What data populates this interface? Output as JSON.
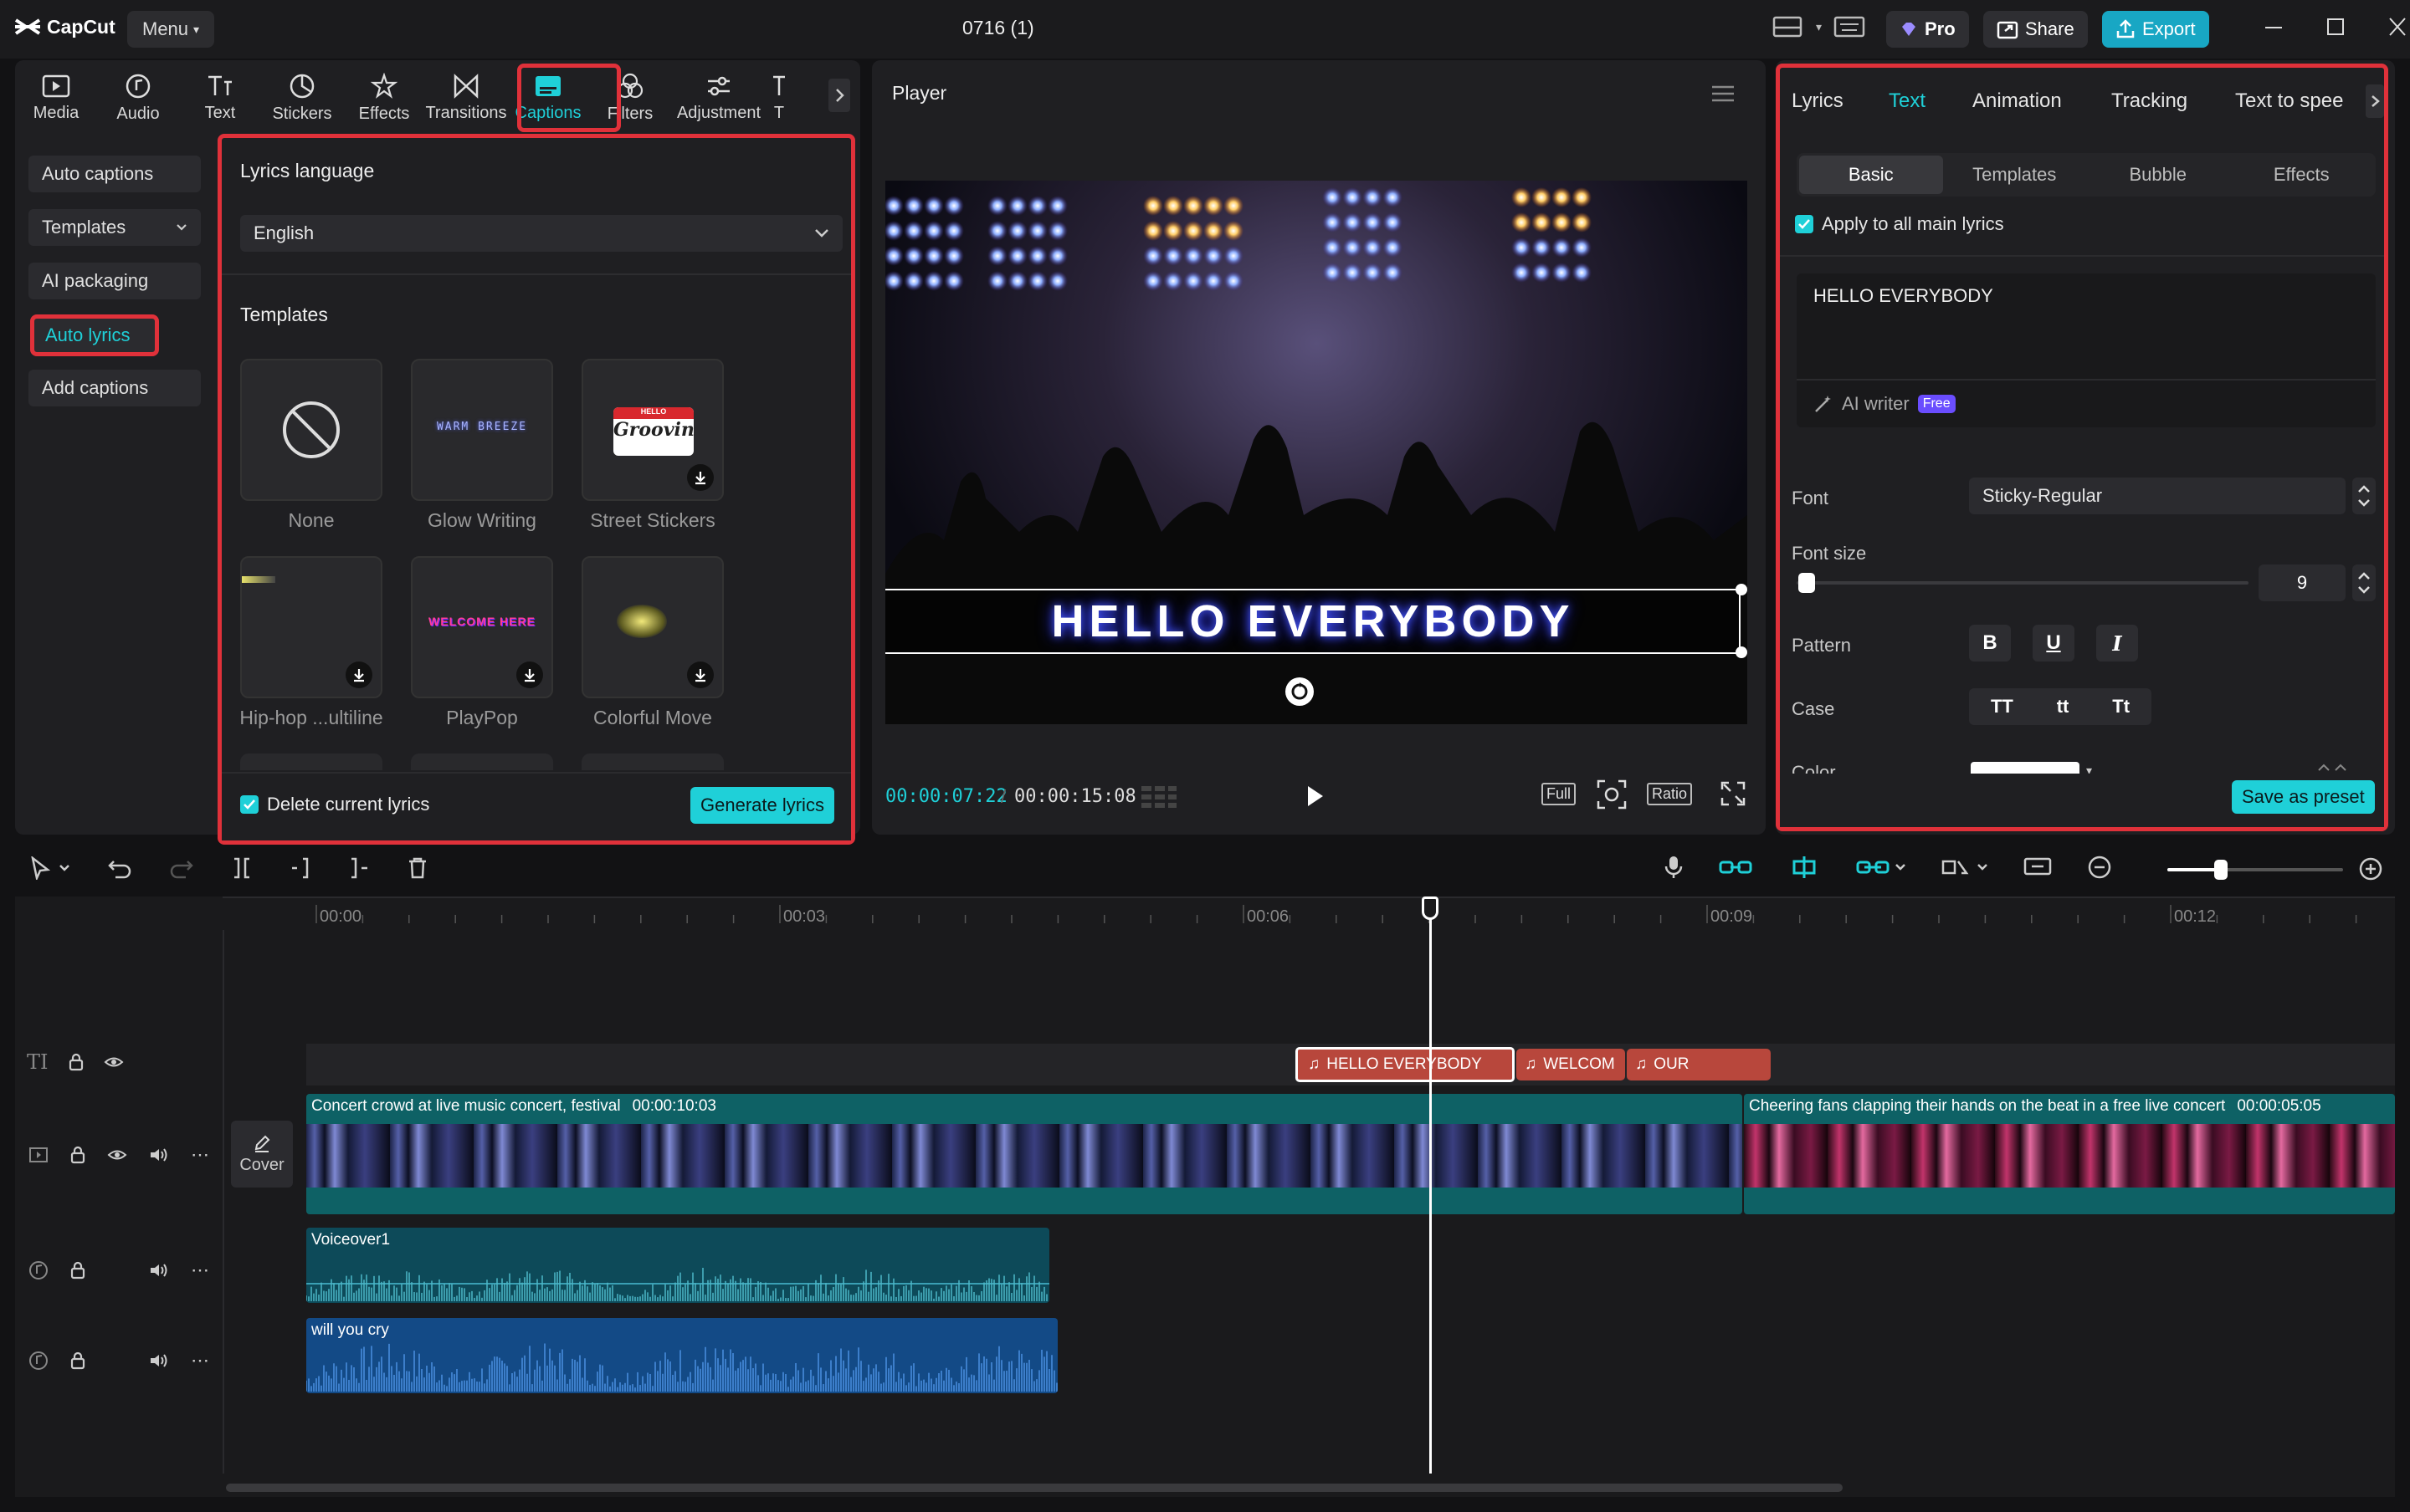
{
  "app": {
    "logo": "CapCut",
    "menu": "Menu",
    "title": "0716 (1)",
    "pro": "Pro",
    "share": "Share",
    "export": "Export"
  },
  "tools": [
    {
      "label": "Media",
      "icon": "media-icon"
    },
    {
      "label": "Audio",
      "icon": "audio-icon"
    },
    {
      "label": "Text",
      "icon": "text-icon"
    },
    {
      "label": "Stickers",
      "icon": "stickers-icon"
    },
    {
      "label": "Effects",
      "icon": "effects-icon"
    },
    {
      "label": "Transitions",
      "icon": "transitions-icon"
    },
    {
      "label": "Captions",
      "icon": "captions-icon",
      "active": true
    },
    {
      "label": "Filters",
      "icon": "filters-icon"
    },
    {
      "label": "Adjustment",
      "icon": "adjustment-icon"
    },
    {
      "label": "T",
      "icon": "more-icon"
    }
  ],
  "sidebar": {
    "items": [
      "Auto captions",
      "Templates",
      "AI packaging",
      "Auto lyrics",
      "Add captions"
    ],
    "active": "Auto lyrics"
  },
  "lyrics_panel": {
    "language_label": "Lyrics language",
    "language_value": "English",
    "templates_label": "Templates",
    "templates": [
      "None",
      "Glow Writing",
      "Street Stickers",
      "Hip-hop ...ultiline",
      "PlayPop",
      "Colorful Move"
    ],
    "sticker_text": "Grooving",
    "sticker_hello": "HELLO",
    "glow_text": "WARM BREEZE",
    "playpop_text": "WELCOME HERE",
    "delete_label": "Delete current lyrics",
    "generate_label": "Generate lyrics"
  },
  "player": {
    "title": "Player",
    "caption": "HELLO EVERYBODY",
    "current_time": "00:00:07:22",
    "total_time": "00:00:15:08",
    "full": "Full",
    "ratio": "Ratio"
  },
  "props": {
    "tabs": [
      "Lyrics",
      "Text",
      "Animation",
      "Tracking",
      "Text to spee"
    ],
    "active_tab": "Text",
    "subtabs": [
      "Basic",
      "Templates",
      "Bubble",
      "Effects"
    ],
    "active_subtab": "Basic",
    "apply_all": "Apply to all main lyrics",
    "text_value": "HELLO EVERYBODY",
    "ai_writer": "AI writer",
    "free_badge": "Free",
    "font_label": "Font",
    "font_value": "Sticky-Regular",
    "font_size_label": "Font size",
    "font_size_value": "9",
    "pattern_label": "Pattern",
    "pattern_btns": [
      "B",
      "U",
      "I"
    ],
    "case_label": "Case",
    "case_btns": [
      "TT",
      "tt",
      "Tt"
    ],
    "color_label": "Color",
    "save_preset": "Save as preset"
  },
  "timeline": {
    "ruler": [
      "00:00",
      "00:03",
      "00:06",
      "00:09",
      "00:12"
    ],
    "lyric_clips": [
      "HELLO EVERYBODY",
      "WELCOM",
      "OUR"
    ],
    "video_clips": [
      {
        "title": "Concert crowd at live music concert, festival",
        "duration": "00:00:10:03"
      },
      {
        "title": "Cheering fans clapping their hands on the beat in a free live concert",
        "duration": "00:00:05:05"
      }
    ],
    "cover": "Cover",
    "audio_clips": [
      "Voiceover1",
      "will you cry"
    ]
  },
  "colors": {
    "accent": "#1fd0d8",
    "red": "#e0313a",
    "lyric_clip": "#b8473c",
    "video_track": "#0e6165",
    "audio1": "#0d4a59",
    "audio2": "#134a86"
  }
}
